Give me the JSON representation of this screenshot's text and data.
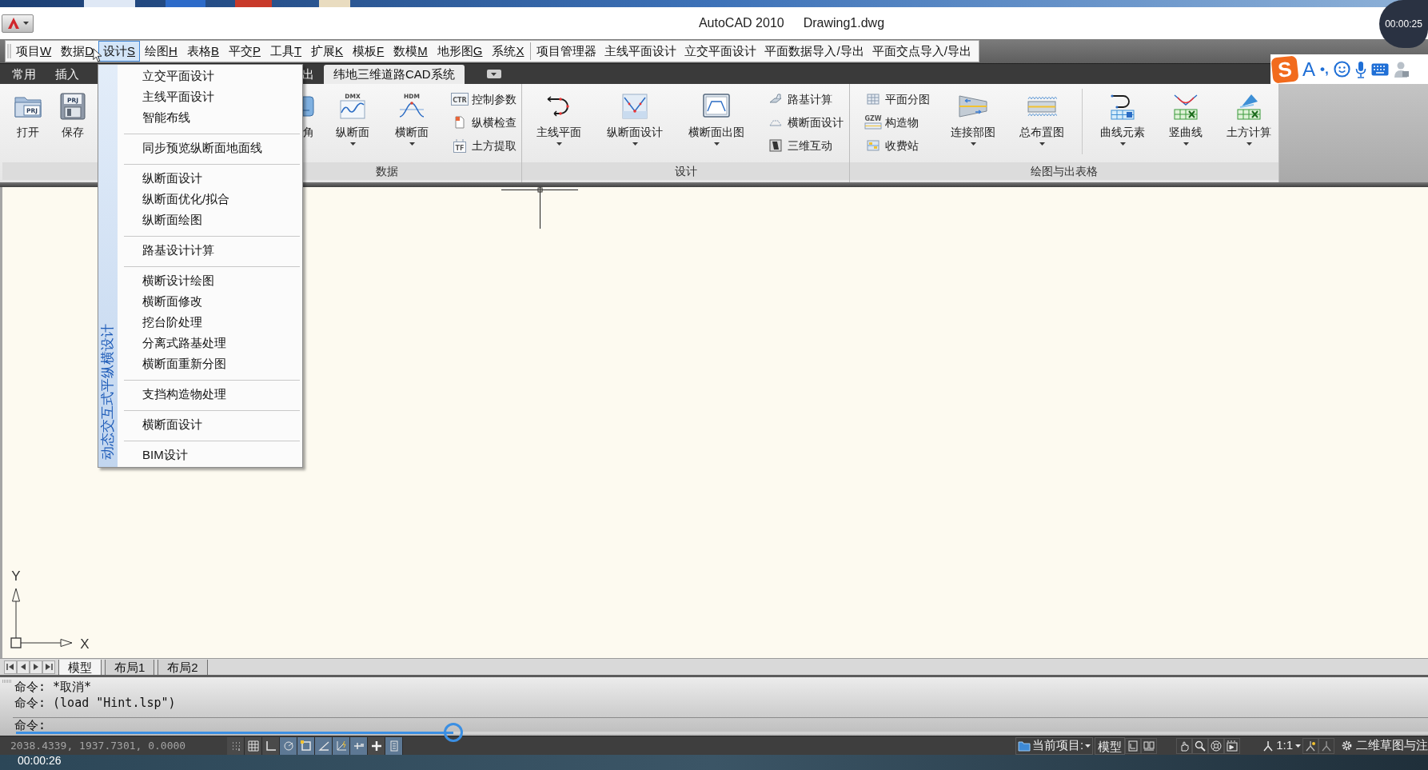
{
  "window": {
    "title": "AutoCAD 2010",
    "document": "Drawing1.dwg"
  },
  "menu_bar": {
    "menus": [
      {
        "label": "项目",
        "key": "W",
        "selected": false
      },
      {
        "label": "数据",
        "key": "D",
        "selected": false
      },
      {
        "label": "设计",
        "key": "S",
        "selected": true
      },
      {
        "label": "绘图",
        "key": "H",
        "selected": false
      },
      {
        "label": "表格",
        "key": "B",
        "selected": false
      },
      {
        "label": "平交",
        "key": "P",
        "selected": false
      },
      {
        "label": "工具",
        "key": "T",
        "selected": false
      },
      {
        "label": "扩展",
        "key": "K",
        "selected": false
      },
      {
        "label": "模板",
        "key": "F",
        "selected": false
      },
      {
        "label": "数模",
        "key": "M",
        "selected": false
      },
      {
        "label": "地形图",
        "key": "G",
        "selected": false
      },
      {
        "label": "系统",
        "key": "X",
        "selected": false
      }
    ],
    "commands": [
      "项目管理器",
      "主线平面设计",
      "立交平面设计",
      "平面数据导入/导出",
      "平面交点导入/导出"
    ]
  },
  "ribbon": {
    "tabs": [
      {
        "label": "常用",
        "selected": false
      },
      {
        "label": "插入",
        "selected": false
      },
      {
        "label": "出",
        "selected": false
      },
      {
        "label": "纬地三维道路CAD系统",
        "selected": true
      }
    ],
    "panels": [
      {
        "items": [
          {
            "kind": "large",
            "label": "打开",
            "icon_text": "PRJ",
            "dropdown": false
          },
          {
            "kind": "large",
            "label": "保存",
            "icon_text": "PRJ",
            "dropdown": false
          }
        ]
      },
      {
        "label": "数据",
        "items": [
          {
            "kind": "large",
            "label": "角",
            "dropdown": false
          },
          {
            "kind": "large",
            "label": "纵断面",
            "icon_text": "DMX",
            "dropdown": true
          },
          {
            "kind": "large",
            "label": "横断面",
            "icon_text": "HDM",
            "dropdown": true
          },
          {
            "kind": "stack",
            "items": [
              {
                "label": "控制参数",
                "icon_text": "CTR"
              },
              {
                "label": "纵横检查"
              },
              {
                "label": "土方提取",
                "icon_text": "TF"
              }
            ]
          }
        ]
      },
      {
        "label": "设计",
        "items": [
          {
            "kind": "large",
            "label": "主线平面",
            "dropdown": true
          },
          {
            "kind": "large",
            "label": "纵断面设计",
            "dropdown": true
          },
          {
            "kind": "large",
            "label": "横断面出图",
            "dropdown": true
          },
          {
            "kind": "stack",
            "items": [
              {
                "label": "路基计算"
              },
              {
                "label": "横断面设计"
              },
              {
                "label": "三维互动"
              }
            ]
          }
        ]
      },
      {
        "label": "绘图与出表格",
        "items": [
          {
            "kind": "stack",
            "items": [
              {
                "label": "平面分图"
              },
              {
                "label": "构造物",
                "icon_text": "GZW"
              },
              {
                "label": "收费站"
              }
            ]
          },
          {
            "kind": "large",
            "label": "连接部图",
            "dropdown": true
          },
          {
            "kind": "large",
            "label": "总布置图",
            "dropdown": true
          },
          {
            "kind": "separator"
          },
          {
            "kind": "large",
            "label": "曲线元素",
            "dropdown": true
          },
          {
            "kind": "large",
            "label": "竖曲线",
            "dropdown": true
          },
          {
            "kind": "large",
            "label": "土方计算",
            "dropdown": true
          }
        ]
      }
    ]
  },
  "dropdown_menu": {
    "side_title": "动态交互式平纵横设计",
    "groups": [
      {
        "items": [
          "立交平面设计",
          "主线平面设计",
          "智能布线"
        ]
      },
      {
        "items": [
          "同步预览纵断面地面线"
        ]
      },
      {
        "items": [
          "纵断面设计",
          "纵断面优化/拟合",
          "纵断面绘图"
        ]
      },
      {
        "items": [
          "路基设计计算"
        ]
      },
      {
        "items": [
          "横断设计绘图",
          "横断面修改",
          "挖台阶处理",
          "分离式路基处理",
          "横断面重新分图"
        ]
      },
      {
        "items": [
          "支挡构造物处理"
        ]
      },
      {
        "items": [
          "横断面设计"
        ]
      },
      {
        "items": [
          "BIM设计"
        ]
      }
    ]
  },
  "ime_toolbar": {
    "logo": "S",
    "mode": "A",
    "punctuation": "•,"
  },
  "canvas": {
    "ucs": {
      "x_label": "X",
      "y_label": "Y"
    }
  },
  "layout_tabs": [
    {
      "label": "模型",
      "selected": true
    },
    {
      "label": "布局1",
      "selected": false
    },
    {
      "label": "布局2",
      "selected": false
    }
  ],
  "command_line": {
    "history": [
      "命令: *取消*",
      "命令: (load \"Hint.lsp\")"
    ],
    "prompt": "命令:"
  },
  "status_bar": {
    "coordinates": "2038.4339, 1937.7301, 0.0000",
    "toggles": [
      {
        "on": false
      },
      {
        "on": false
      },
      {
        "on": false
      },
      {
        "on": true
      },
      {
        "on": true
      },
      {
        "on": true
      },
      {
        "on": true
      },
      {
        "on": true
      },
      {
        "on": false
      },
      {
        "on": true
      }
    ],
    "project_label": "当前项目:",
    "space": "模型",
    "annotation_scale": "1:1",
    "workspace": "二维草图与注"
  },
  "recording": {
    "elapsed_top": "00:00:25",
    "elapsed_bottom": "00:00:26",
    "progress": {
      "level": 0.31
    }
  }
}
